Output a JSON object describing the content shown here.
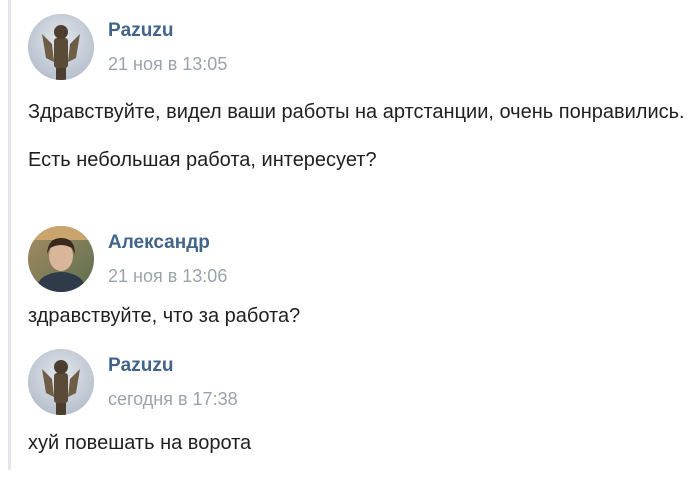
{
  "messages": [
    {
      "author": "Pazuzu",
      "time": "21 ноя в 13:05",
      "avatar": "statue-avatar",
      "paragraphs": [
        "Здравствуйте, видел ваши работы на артстанции, очень понравились.",
        "Есть небольшая работа, интересует?"
      ]
    },
    {
      "author": "Александр",
      "time": "21 ноя в 13:06",
      "avatar": "person-photo-avatar",
      "paragraphs": [
        "здравствуйте, что за работа?"
      ]
    },
    {
      "author": "Pazuzu",
      "time": "сегодня в 17:38",
      "avatar": "statue-avatar",
      "paragraphs": [
        "хуй повешать на ворота"
      ]
    }
  ],
  "colors": {
    "author": "#42648b",
    "timestamp": "#9aa3ad",
    "text": "#1f1f1f",
    "rule": "#e4e6ea"
  }
}
